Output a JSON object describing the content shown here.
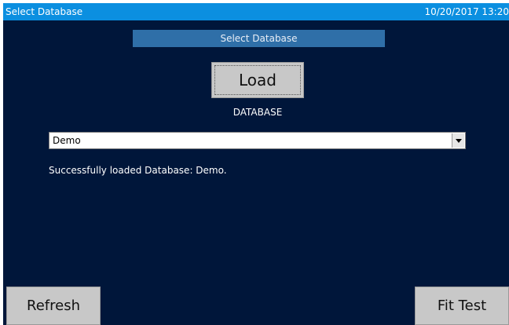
{
  "titlebar": {
    "title": "Select Database",
    "datetime": "10/20/2017 13:20"
  },
  "section": {
    "header": "Select Database"
  },
  "actions": {
    "load_label": "Load",
    "refresh_label": "Refresh",
    "fit_test_label": "Fit Test"
  },
  "database": {
    "label": "DATABASE",
    "selected": "Demo"
  },
  "status": {
    "message": "Successfully loaded Database: Demo."
  },
  "colors": {
    "background": "#00163a",
    "titlebar": "#0b8fe0",
    "section_header": "#2f6fa8",
    "button": "#c8c8c8"
  }
}
